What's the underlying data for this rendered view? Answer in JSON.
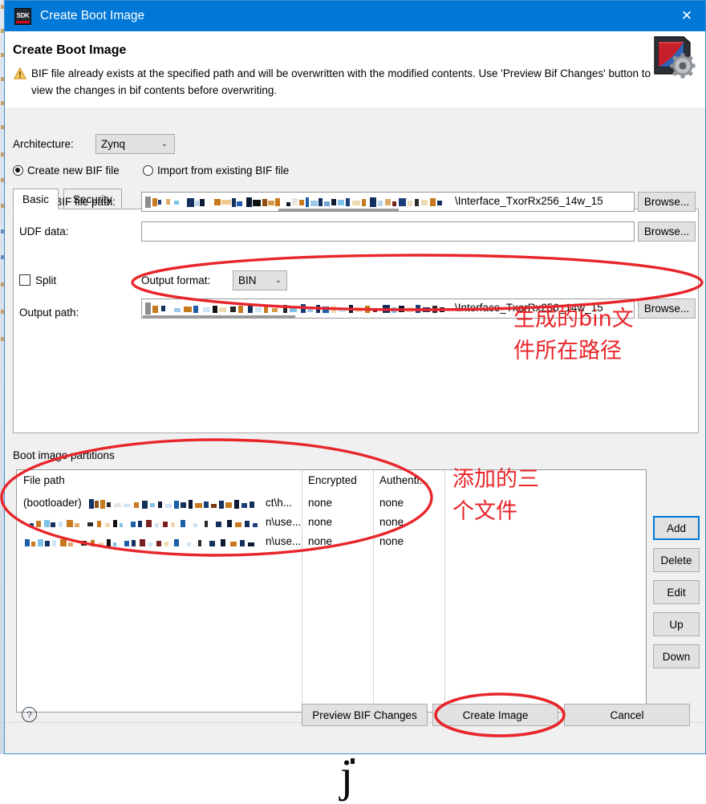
{
  "window": {
    "title": "Create Boot Image",
    "icon": "sdk-icon",
    "icon_text": "SDK",
    "close_glyph": "✕"
  },
  "header": {
    "title": "Create Boot Image",
    "warning_icon": "warning-triangle-icon",
    "warning_text": "BIF file already exists at the specified path and will be overwritten with the modified contents. Use 'Preview Bif Changes' button to view the changes in bif contents before overwriting."
  },
  "architecture": {
    "label": "Architecture:",
    "value": "Zynq",
    "chevron": "⌄"
  },
  "bif_source": {
    "create_new": "Create new BIF file",
    "import_existing": "Import from existing BIF file",
    "selected": "create_new"
  },
  "tabs": [
    {
      "label": "Basic",
      "active": true
    },
    {
      "label": "Security",
      "active": false
    }
  ],
  "basic": {
    "output_bif_label": "Output BIF file path:",
    "output_bif_value": "\\Interface_TxorRx256_14w_15",
    "udf_label": "UDF data:",
    "udf_value": "",
    "split_label": "Split",
    "split_checked": false,
    "output_format_label": "Output format:",
    "output_format_value": "BIN",
    "output_path_label": "Output path:",
    "output_path_value": "\\Interface_TxorRx256_14w_15",
    "browse_label": "Browse..."
  },
  "partitions": {
    "group_title": "Boot image partitions",
    "columns": [
      "File path",
      "Encrypted",
      "Authenti..."
    ],
    "rows": [
      {
        "file_path_prefix": "(bootloader)",
        "file_path_tail": "ct\\h...",
        "encrypted": "none",
        "authentication": "none"
      },
      {
        "file_path_prefix": "",
        "file_path_tail": "n\\use...",
        "encrypted": "none",
        "authentication": "none"
      },
      {
        "file_path_prefix": "",
        "file_path_tail": "n\\use...",
        "encrypted": "none",
        "authentication": "none"
      }
    ],
    "side_buttons": [
      {
        "label": "Add",
        "focused": true
      },
      {
        "label": "Delete",
        "focused": false
      },
      {
        "label": "Edit",
        "focused": false
      },
      {
        "label": "Up",
        "focused": false
      },
      {
        "label": "Down",
        "focused": false
      }
    ]
  },
  "footer": {
    "help_glyph": "?",
    "preview_label": "Preview BIF Changes",
    "create_label": "Create Image",
    "cancel_label": "Cancel"
  },
  "annotations": {
    "path_note": "生成的bin文\n件所在路径",
    "files_note": "添加的三\n个文件",
    "highlight_color": "#e8252a"
  },
  "background": {
    "stray_letter": "j"
  }
}
